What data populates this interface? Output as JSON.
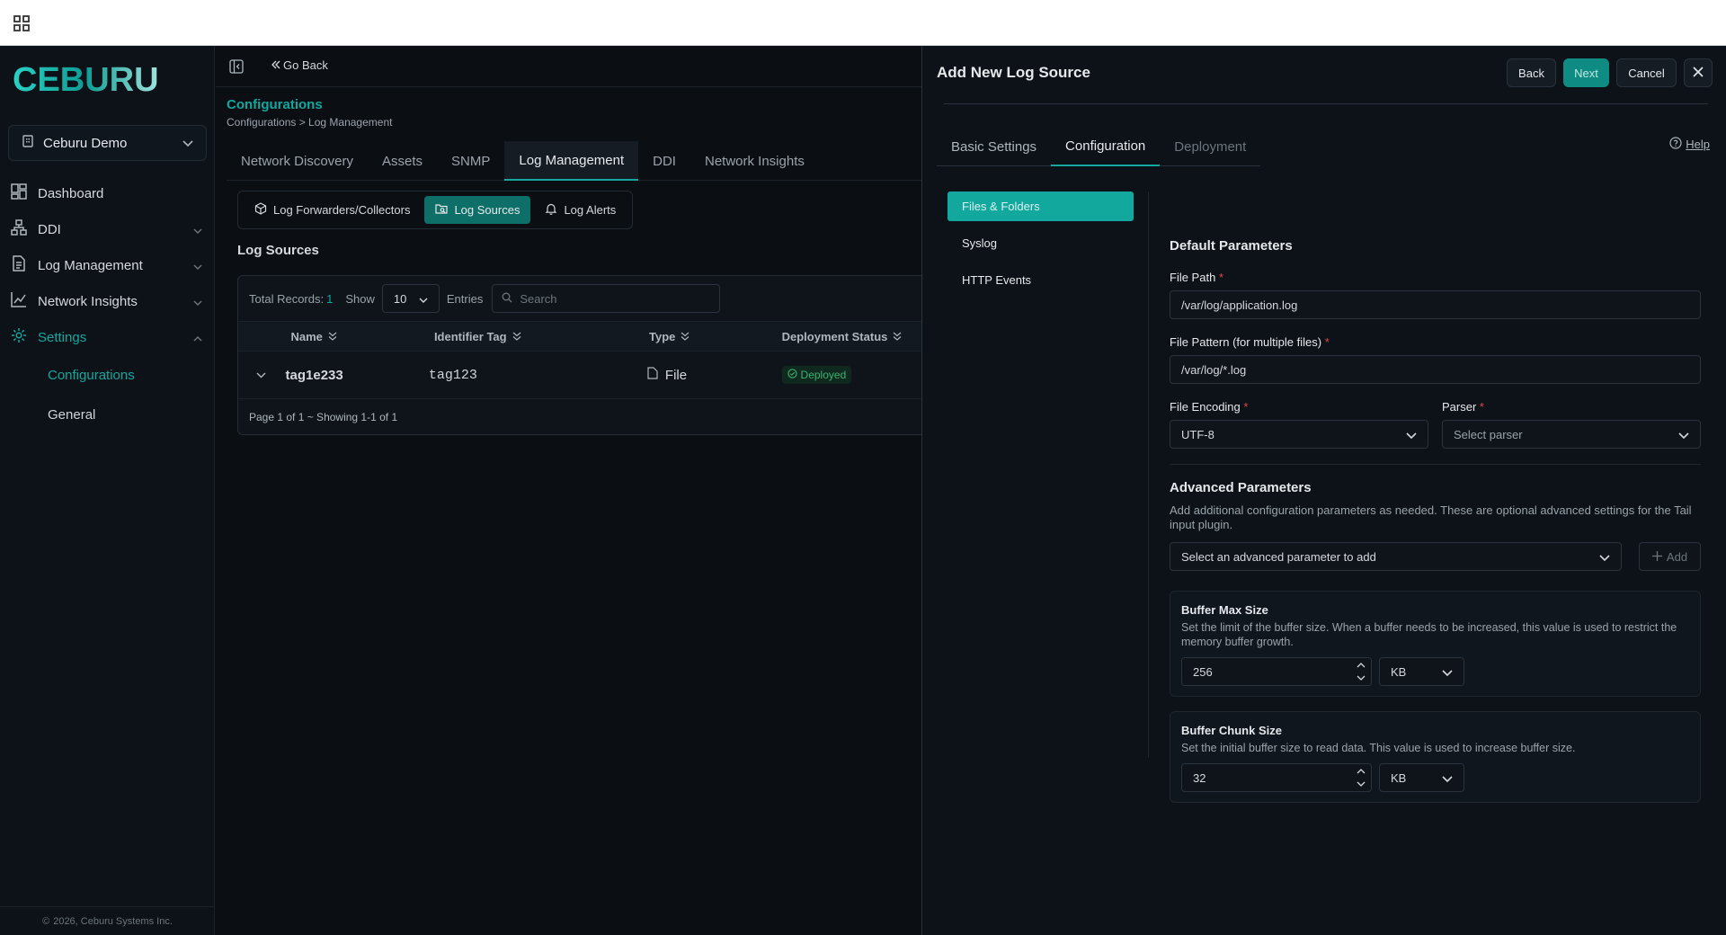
{
  "topbar": {
    "apps_icon": "grid-icon"
  },
  "sidebar": {
    "logo_text": "CEBURU",
    "org": "Ceburu Demo",
    "nav": [
      {
        "label": "Dashboard",
        "icon": "dashboard-icon"
      },
      {
        "label": "DDI",
        "icon": "network-icon"
      },
      {
        "label": "Log Management",
        "icon": "document-icon"
      },
      {
        "label": "Network Insights",
        "icon": "chart-icon"
      },
      {
        "label": "Settings",
        "icon": "gear-icon"
      }
    ],
    "sub": [
      "Configurations",
      "General"
    ],
    "footer": "2026, Ceburu Systems Inc."
  },
  "main": {
    "go_back": "Go Back",
    "title": "Configurations",
    "breadcrumb": "Configurations > Log Management",
    "tabs": [
      "Network Discovery",
      "Assets",
      "SNMP",
      "Log Management",
      "DDI",
      "Network Insights"
    ],
    "subtabs": [
      "Log Forwarders/Collectors",
      "Log Sources",
      "Log Alerts"
    ],
    "section_title": "Log Sources",
    "total_label": "Total Records:",
    "total_value": "1",
    "show_label": "Show",
    "show_value": "10",
    "entries_label": "Entries",
    "search_placeholder": "Search",
    "columns": [
      "Name",
      "Identifier Tag",
      "Type",
      "Deployment Status"
    ],
    "row": {
      "name": "tag1e233",
      "tag": "tag123",
      "type": "File",
      "status": "Deployed"
    },
    "pagination": "Page 1 of 1 ~ Showing 1-1 of 1"
  },
  "drawer": {
    "title": "Add New Log Source",
    "back": "Back",
    "next": "Next",
    "cancel": "Cancel",
    "tabs": [
      "Basic Settings",
      "Configuration",
      "Deployment"
    ],
    "help": "Help",
    "side": [
      "Files & Folders",
      "Syslog",
      "HTTP Events"
    ],
    "default_params": "Default Parameters",
    "file_path_label": "File Path",
    "file_path_value": "/var/log/application.log",
    "file_pattern_label": "File Pattern (for multiple files)",
    "file_pattern_value": "/var/log/*.log",
    "encoding_label": "File Encoding",
    "encoding_value": "UTF-8",
    "parser_label": "Parser",
    "parser_placeholder": "Select parser",
    "advanced_title": "Advanced Parameters",
    "advanced_desc": "Add additional configuration parameters as needed. These are optional advanced settings for the Tail input plugin.",
    "advanced_select": "Select an advanced parameter to add",
    "add_button": "Add",
    "buffer_max": {
      "title": "Buffer Max Size",
      "desc": "Set the limit of the buffer size. When a buffer needs to be increased, this value is used to restrict the memory buffer growth.",
      "value": "256",
      "unit": "KB"
    },
    "buffer_chunk": {
      "title": "Buffer Chunk Size",
      "desc": "Set the initial buffer size to read data. This value is used to increase buffer size.",
      "value": "32",
      "unit": "KB"
    }
  },
  "colors": {
    "accent": "#13a89e",
    "background": "#0b0f14",
    "required": "#e0474b",
    "deployed": "#3cb371"
  }
}
